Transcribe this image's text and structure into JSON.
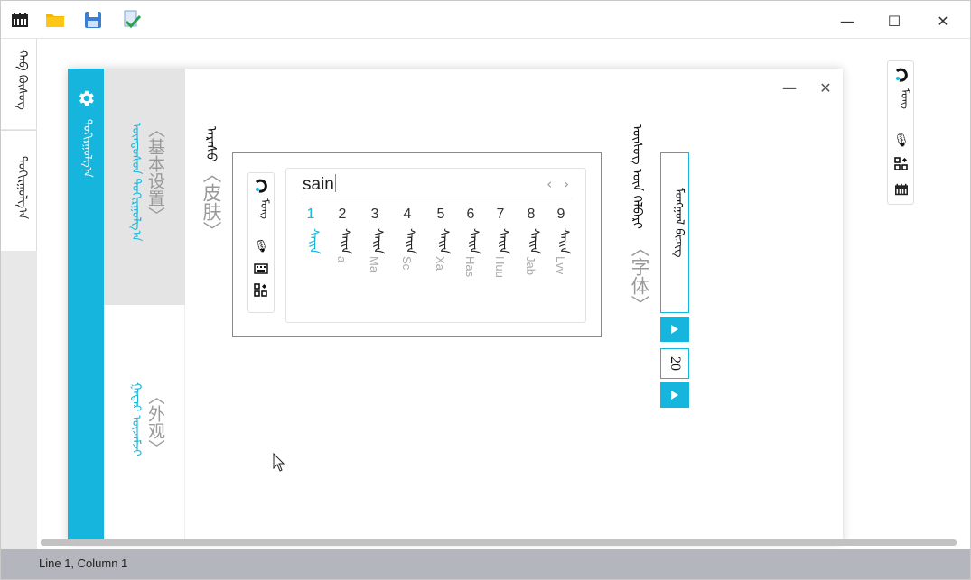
{
  "toolbar": {
    "icons": [
      "calendar-icon",
      "folder-icon",
      "save-icon",
      "document-check-icon"
    ]
  },
  "window_controls": {
    "minimize": "—",
    "maximize": "☐",
    "close": "✕"
  },
  "left_tabs": [
    {
      "label": "ᠬᠠᠪ ᠬᠦᠰᠦᠭ"
    },
    {
      "label": "ᠲᠣᠬᠢᠷᠭᠤᠯᠭ᠎ᠠ"
    }
  ],
  "dialog": {
    "sidebar_label": "ᠲᠣᠬᠢᠷᠭᠤᠯᠭ᠎ᠠ",
    "nav": [
      {
        "mongolian": "ᠦᠨᠳᠦᠰᠦᠨ ᠲᠣᠬᠢᠷᠭᠤᠯᠭ᠎ᠠ",
        "chinese": "〈基本设置〉",
        "active": true
      },
      {
        "mongolian": "ᠭᠠᠳᠠᠷ ᠦᠵᠡᠮᠵᠢ",
        "chinese": "〈外观〉",
        "active": false
      }
    ],
    "skin_label": {
      "mongolian": "ᠠᠷᠠᠰᠤ",
      "chinese": "〈皮肤〉"
    },
    "font_label": {
      "mongolian": "ᠦᠰᠦᠭ ᠦᠨ ᠬᠡᠯᠪᠡᠷᠢ",
      "chinese": "〈字体〉"
    },
    "font_value": "ᠮᠣᠩᠭᠣᠯ ᠪᠢᠴᠢᠭ",
    "font_size": "20"
  },
  "candidate": {
    "input": "sain",
    "items": [
      {
        "num": "1",
        "word": "ᠰᠠᠢᠨ",
        "latin": "",
        "highlight": true
      },
      {
        "num": "2",
        "word": "ᠰᠠᠢᠨ",
        "latin": "a"
      },
      {
        "num": "3",
        "word": "ᠰᠠᠢᠨ",
        "latin": "Ma"
      },
      {
        "num": "4",
        "word": "ᠰᠠᠢᠨ",
        "latin": "Sc"
      },
      {
        "num": "5",
        "word": "ᠰᠠᠢᠨ",
        "latin": "Xa"
      },
      {
        "num": "6",
        "word": "ᠰᠠᠢᠨ",
        "latin": "Has"
      },
      {
        "num": "7",
        "word": "ᠰᠠᠢᠨ",
        "latin": "Huu"
      },
      {
        "num": "8",
        "word": "ᠰᠠᠢᠨ",
        "latin": "Jab"
      },
      {
        "num": "9",
        "word": "ᠰᠠᠢᠨ",
        "latin": "Lvv"
      }
    ]
  },
  "statusbar": {
    "text": "Line 1, Column 1"
  },
  "colors": {
    "accent": "#16b5dd",
    "status_bg": "#b3b6bc"
  }
}
